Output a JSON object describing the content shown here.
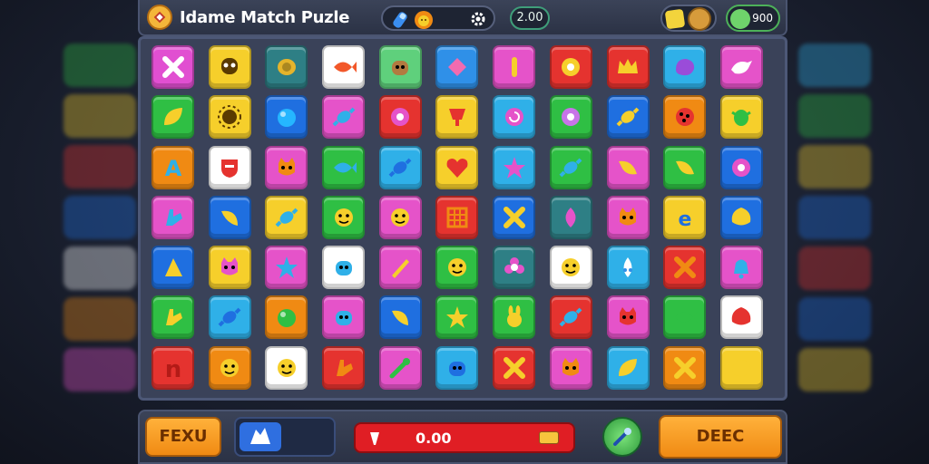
{
  "header": {
    "title": "Idame Match Puzle",
    "score": "2.00",
    "gems": "900",
    "icons": [
      "logo-icon",
      "potion-icon",
      "lion-icon",
      "settings-icon",
      "coin-stack-icon",
      "gem-icon"
    ]
  },
  "board": {
    "rows": [
      [
        {
          "color": "#e14fd1",
          "icon": "cross-icon",
          "fg": "#fff"
        },
        {
          "color": "#f6cf2b",
          "icon": "skull-icon",
          "fg": "#5a3a00"
        },
        {
          "color": "#2e7f85",
          "icon": "coin-icon",
          "fg": "#e5b42b"
        },
        {
          "color": "#ffffff",
          "icon": "fish-icon",
          "fg": "#f2582a"
        },
        {
          "color": "#5fd07c",
          "icon": "creature-icon",
          "fg": "#b27a40"
        },
        {
          "color": "#2f90e8",
          "icon": "bead-icon",
          "fg": "#f06bb0"
        },
        {
          "color": "#e553c9",
          "icon": "bar-icon",
          "fg": "#f6cf2b"
        },
        {
          "color": "#e5332f",
          "icon": "ring-icon",
          "fg": "#f6cf2b"
        },
        {
          "color": "#e5332f",
          "icon": "crown-icon",
          "fg": "#f6cf2b"
        },
        {
          "color": "#2fb0e8",
          "icon": "blob-icon",
          "fg": "#9a4cd9"
        },
        {
          "color": "#e553c9",
          "icon": "bird-icon",
          "fg": "#ffffff"
        },
        {
          "color": "#6b63c9",
          "icon": "bar-icon",
          "fg": "#ffffff"
        }
      ],
      [
        {
          "color": "#2fbf44",
          "icon": "leaf-icon",
          "fg": "#f6cf2b"
        },
        {
          "color": "#f6cf2b",
          "icon": "sun-icon",
          "fg": "#5a3a00"
        },
        {
          "color": "#1f6fe0",
          "icon": "orb-icon",
          "fg": "#25b6ff"
        },
        {
          "color": "#e553c9",
          "icon": "candy-icon",
          "fg": "#2fb0e8"
        },
        {
          "color": "#e5332f",
          "icon": "ring-icon",
          "fg": "#e553c9"
        },
        {
          "color": "#f6cf2b",
          "icon": "cup-icon",
          "fg": "#e5332f"
        },
        {
          "color": "#2fb0e8",
          "icon": "swirl-icon",
          "fg": "#e553c9"
        },
        {
          "color": "#2fbf44",
          "icon": "ring-icon",
          "fg": "#c774e8"
        },
        {
          "color": "#1f6fe0",
          "icon": "candy-icon",
          "fg": "#f6cf2b"
        },
        {
          "color": "#f08a13",
          "icon": "cookie-icon",
          "fg": "#e5332f"
        },
        {
          "color": "#f6cf2b",
          "icon": "bug-icon",
          "fg": "#2fbf44"
        },
        {
          "color": "#2fb0e8",
          "icon": "bar-icon",
          "fg": "#1f6fe0"
        }
      ],
      [
        {
          "color": "#f08a13",
          "icon": "letter-a-icon",
          "fg": "#2fb0e8"
        },
        {
          "color": "#ffffff",
          "icon": "shield-icon",
          "fg": "#e5332f"
        },
        {
          "color": "#e553c9",
          "icon": "cat-icon",
          "fg": "#f08a13"
        },
        {
          "color": "#2fbf44",
          "icon": "fish-icon",
          "fg": "#2fb0e8"
        },
        {
          "color": "#2fb0e8",
          "icon": "candy-icon",
          "fg": "#1f6fe0"
        },
        {
          "color": "#f6cf2b",
          "icon": "heart-icon",
          "fg": "#e5332f"
        },
        {
          "color": "#2fb0e8",
          "icon": "star-icon",
          "fg": "#e553c9"
        },
        {
          "color": "#2fbf44",
          "icon": "candy-icon",
          "fg": "#2fb0e8"
        },
        {
          "color": "#e553c9",
          "icon": "horn-icon",
          "fg": "#f6cf2b"
        },
        {
          "color": "#2fbf44",
          "icon": "horn-icon",
          "fg": "#f6cf2b"
        },
        {
          "color": "#1f6fe0",
          "icon": "ring-icon",
          "fg": "#e553c9"
        },
        {
          "color": "#2e7f85",
          "icon": "bar-icon",
          "fg": "#2fbf44"
        }
      ],
      [
        {
          "color": "#e553c9",
          "icon": "hand-icon",
          "fg": "#2fb0e8"
        },
        {
          "color": "#1f6fe0",
          "icon": "banana-icon",
          "fg": "#f6cf2b"
        },
        {
          "color": "#f6cf2b",
          "icon": "candy-icon",
          "fg": "#2fb0e8"
        },
        {
          "color": "#2fbf44",
          "icon": "face-icon",
          "fg": "#f6cf2b"
        },
        {
          "color": "#e553c9",
          "icon": "face-icon",
          "fg": "#f6cf2b"
        },
        {
          "color": "#e5332f",
          "icon": "grid-icon",
          "fg": "#f08a13"
        },
        {
          "color": "#1f6fe0",
          "icon": "cross-icon",
          "fg": "#f6cf2b"
        },
        {
          "color": "#2e7f85",
          "icon": "gem-drop-icon",
          "fg": "#e553c9"
        },
        {
          "color": "#e553c9",
          "icon": "cat-icon",
          "fg": "#f08a13"
        },
        {
          "color": "#f6cf2b",
          "icon": "letter-e-icon",
          "fg": "#1f6fe0"
        },
        {
          "color": "#1f6fe0",
          "icon": "shell-icon",
          "fg": "#f6cf2b"
        },
        {
          "color": "#1f6fe0",
          "icon": "bar-icon",
          "fg": "#2fbf44"
        }
      ],
      [
        {
          "color": "#1f6fe0",
          "icon": "triangle-icon",
          "fg": "#f6cf2b"
        },
        {
          "color": "#f6cf2b",
          "icon": "cat-icon",
          "fg": "#e553c9"
        },
        {
          "color": "#e553c9",
          "icon": "star-icon",
          "fg": "#2fb0e8"
        },
        {
          "color": "#ffffff",
          "icon": "creature-icon",
          "fg": "#2fb0e8"
        },
        {
          "color": "#e553c9",
          "icon": "sword-icon",
          "fg": "#f6cf2b"
        },
        {
          "color": "#2fbf44",
          "icon": "face-icon",
          "fg": "#f6cf2b"
        },
        {
          "color": "#2e7f85",
          "icon": "flower-icon",
          "fg": "#e553c9"
        },
        {
          "color": "#ffffff",
          "icon": "face-icon",
          "fg": "#f6cf2b"
        },
        {
          "color": "#2fb0e8",
          "icon": "drop-icon",
          "fg": "#ffffff"
        },
        {
          "color": "#e5332f",
          "icon": "cross-icon",
          "fg": "#f08a13"
        },
        {
          "color": "#e553c9",
          "icon": "bell-icon",
          "fg": "#2fb0e8"
        },
        {
          "color": "#1f3ac9",
          "icon": "bar-icon",
          "fg": "#ffffff"
        }
      ],
      [
        {
          "color": "#2fbf44",
          "icon": "hand-icon",
          "fg": "#f6cf2b"
        },
        {
          "color": "#2fb0e8",
          "icon": "candy-icon",
          "fg": "#1f6fe0"
        },
        {
          "color": "#f08a13",
          "icon": "orb-icon",
          "fg": "#2fbf44"
        },
        {
          "color": "#e553c9",
          "icon": "creature-icon",
          "fg": "#2fb0e8"
        },
        {
          "color": "#1f6fe0",
          "icon": "banana-icon",
          "fg": "#f6cf2b"
        },
        {
          "color": "#2fbf44",
          "icon": "star-icon",
          "fg": "#f6cf2b"
        },
        {
          "color": "#2fbf44",
          "icon": "bunny-icon",
          "fg": "#f6cf2b"
        },
        {
          "color": "#e5332f",
          "icon": "candy-icon",
          "fg": "#2fb0e8"
        },
        {
          "color": "#e553c9",
          "icon": "cat-icon",
          "fg": "#e5332f"
        },
        {
          "color": "#2fbf44",
          "icon": "fish-icon",
          "fg": "#2fbf44"
        },
        {
          "color": "#ffffff",
          "icon": "shell-icon",
          "fg": "#e5332f"
        },
        {
          "color": "#2fb0e8",
          "icon": "blank-icon",
          "fg": "#2fb0e8"
        }
      ],
      [
        {
          "color": "#e5332f",
          "icon": "letter-n-icon",
          "fg": "#e5332f"
        },
        {
          "color": "#f08a13",
          "icon": "face-icon",
          "fg": "#f6cf2b"
        },
        {
          "color": "#ffffff",
          "icon": "face-icon",
          "fg": "#f6cf2b"
        },
        {
          "color": "#e5332f",
          "icon": "hand-icon",
          "fg": "#f08a13"
        },
        {
          "color": "#e553c9",
          "icon": "tool-icon",
          "fg": "#2fbf44"
        },
        {
          "color": "#2fb0e8",
          "icon": "creature-icon",
          "fg": "#1f6fe0"
        },
        {
          "color": "#e5332f",
          "icon": "cross-icon",
          "fg": "#f6cf2b"
        },
        {
          "color": "#e553c9",
          "icon": "cat-icon",
          "fg": "#f08a13"
        },
        {
          "color": "#2fb0e8",
          "icon": "leaf-icon",
          "fg": "#f6cf2b"
        },
        {
          "color": "#f08a13",
          "icon": "cross-icon",
          "fg": "#f6cf2b"
        },
        {
          "color": "#f6cf2b",
          "icon": "blob-icon",
          "fg": "#f6cf2b"
        },
        {
          "color": "#1f6fe0",
          "icon": "sparkle-icon",
          "fg": "#f6cf2b"
        }
      ]
    ]
  },
  "footer": {
    "left_button": "FEXU",
    "tool_icon": "wolf-icon",
    "progress_value": "0.00",
    "round_icon": "wand-icon",
    "right_button": "DEEC"
  }
}
